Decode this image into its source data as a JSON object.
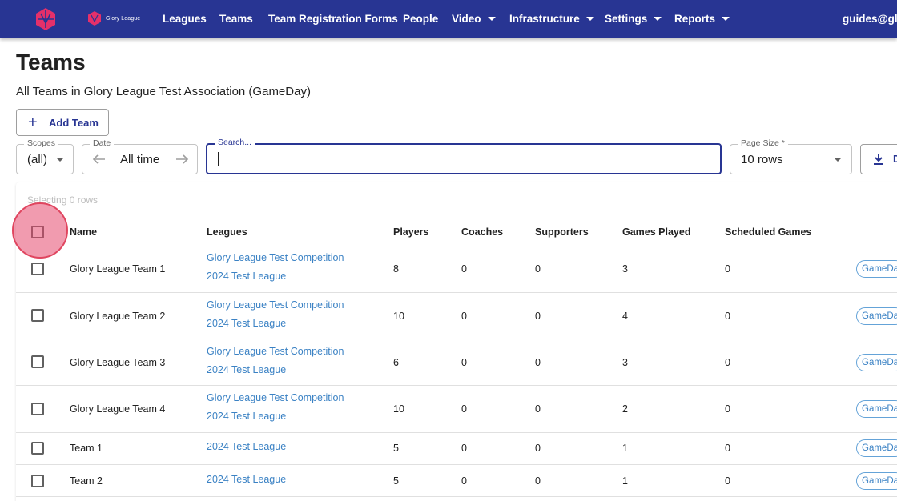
{
  "nav": {
    "brand_text": "Glory League",
    "items": [
      "Leagues",
      "Teams",
      "Team Registration Forms",
      "People",
      "Video",
      "Infrastructure",
      "Settings",
      "Reports"
    ],
    "user": "guides@glo",
    "colors": {
      "bar": "#283593",
      "logo": "#e5306a"
    }
  },
  "page": {
    "title": "Teams",
    "subtitle": "All Teams in Glory League Test Association (GameDay)",
    "add_button": "Add Team"
  },
  "filters": {
    "scopes_label": "Scopes",
    "scopes_value": "(all)",
    "date_label": "Date",
    "date_value": "All time",
    "search_label": "Search...",
    "search_value": "",
    "page_size_label": "Page Size *",
    "page_size_value": "10 rows",
    "download_label": "D"
  },
  "table": {
    "selecting": "Selecting 0 rows",
    "headers": [
      "Name",
      "Leagues",
      "Players",
      "Coaches",
      "Supporters",
      "Games Played",
      "Scheduled Games"
    ],
    "rows": [
      {
        "name": "Glory League Team 1",
        "leagues": [
          "Glory League Test Competition",
          "2024 Test League"
        ],
        "players": "8",
        "coaches": "0",
        "supporters": "0",
        "games_played": "3",
        "scheduled": "0",
        "chip": "GameDa"
      },
      {
        "name": "Glory League Team 2",
        "leagues": [
          "Glory League Test Competition",
          "2024 Test League"
        ],
        "players": "10",
        "coaches": "0",
        "supporters": "0",
        "games_played": "4",
        "scheduled": "0",
        "chip": "GameDa"
      },
      {
        "name": "Glory League Team 3",
        "leagues": [
          "Glory League Test Competition",
          "2024 Test League"
        ],
        "players": "6",
        "coaches": "0",
        "supporters": "0",
        "games_played": "3",
        "scheduled": "0",
        "chip": "GameDa"
      },
      {
        "name": "Glory League Team 4",
        "leagues": [
          "Glory League Test Competition",
          "2024 Test League"
        ],
        "players": "10",
        "coaches": "0",
        "supporters": "0",
        "games_played": "2",
        "scheduled": "0",
        "chip": "GameDa"
      },
      {
        "name": "Team 1",
        "leagues": [
          "2024 Test League"
        ],
        "players": "5",
        "coaches": "0",
        "supporters": "0",
        "games_played": "1",
        "scheduled": "0",
        "chip": "GameDa"
      },
      {
        "name": "Team 2",
        "leagues": [
          "2024 Test League"
        ],
        "players": "5",
        "coaches": "0",
        "supporters": "0",
        "games_played": "1",
        "scheduled": "0",
        "chip": "GameDa"
      }
    ]
  }
}
